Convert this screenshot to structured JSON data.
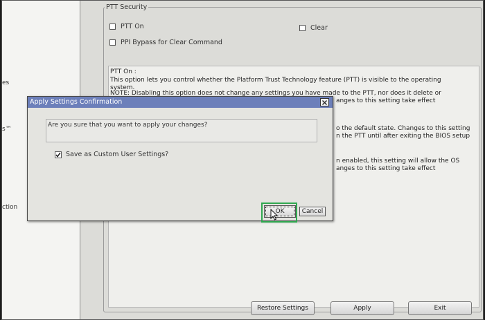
{
  "left_pane": {
    "items": [
      "es",
      "s™",
      "ction"
    ]
  },
  "ptt_security": {
    "group_title": "PTT Security",
    "ptt_on_label": "PTT On",
    "clear_label": "Clear",
    "ppi_bypass_label": "PPI Bypass for Clear Command",
    "description": {
      "lines": [
        "PTT On :",
        "This option lets you control whether the Platform Trust Technology feature (PTT) is visible to the operating",
        "system.",
        "NOTE: Disabling this option does not change any settings you have made to the PTT, nor does it delete or",
        "anges to this setting take effect",
        "o the default state. Changes to this setting",
        "n the PTT until after exiting the BIOS setup",
        "n enabled, this setting will allow the OS",
        "anges to this setting take effect"
      ]
    }
  },
  "bottom_buttons": {
    "restore_label": "Restore Settings",
    "apply_label": "Apply",
    "exit_label": "Exit"
  },
  "dialog": {
    "title": "Apply Settings Confirmation",
    "close_glyph": "×",
    "question": "Are you sure that you want to apply your changes?",
    "save_custom_label": "Save as Custom User Settings?",
    "save_custom_checked": true,
    "ok_label": "OK",
    "cancel_label": "Cancel"
  },
  "colors": {
    "dialog_title_bar": "#6c7fba",
    "highlight": "#2fa84f"
  }
}
